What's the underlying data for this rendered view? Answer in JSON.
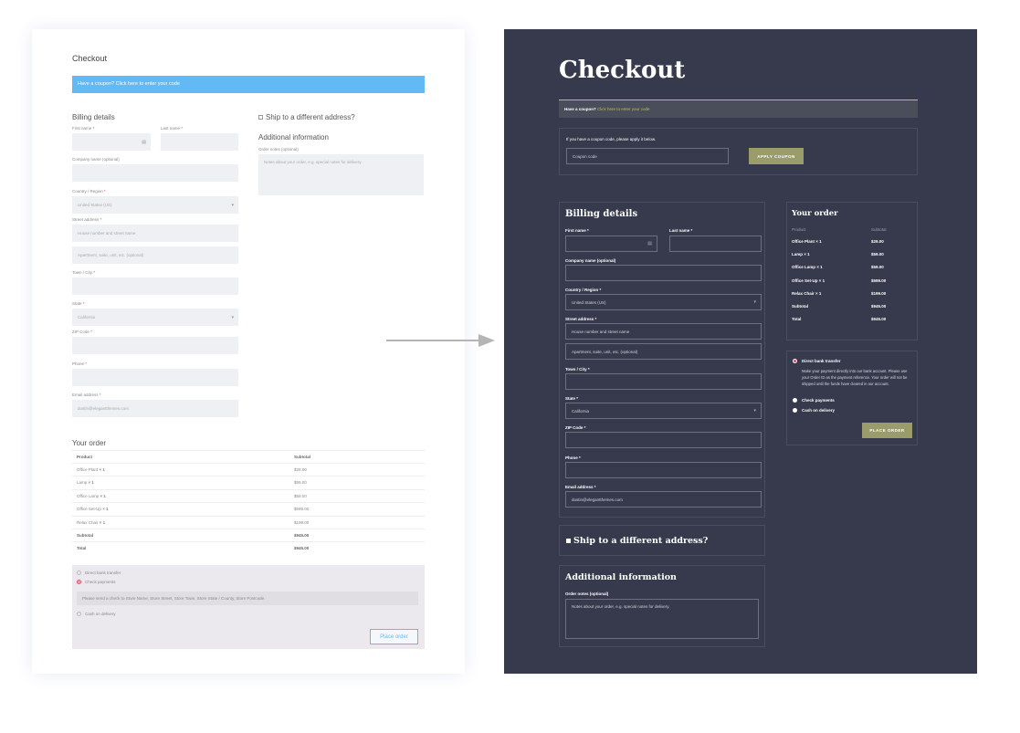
{
  "light": {
    "title": "Checkout",
    "coupon_text": "Have a coupon? Click here to enter your code",
    "billing_title": "Billing details",
    "first_name": "First name",
    "last_name": "Last name",
    "required": "*",
    "company": "Company name (optional)",
    "country_label": "Country / Region",
    "country_value": "United States (US)",
    "street_label": "Street address",
    "street_ph1": "House number and street name",
    "street_ph2": "Apartment, suite, unit, etc. (optional)",
    "town_label": "Town / City",
    "state_label": "State",
    "state_value": "California",
    "zip_label": "ZIP Code",
    "phone_label": "Phone",
    "email_label": "Email address",
    "email_value": "dustin@elegantthemes.com",
    "ship_label": "Ship to a different address?",
    "additional_title": "Additional information",
    "notes_label": "Order notes (optional)",
    "notes_ph": "Notes about your order, e.g. special notes for delivery.",
    "order_title": "Your order",
    "col_product": "Product",
    "col_subtotal": "Subtotal",
    "items": [
      {
        "name": "Office Plant",
        "qty": "× 1",
        "price": "$29.00"
      },
      {
        "name": "Lamp",
        "qty": "× 1",
        "price": "$59.00"
      },
      {
        "name": "Office Lamp",
        "qty": "× 1",
        "price": "$59.00"
      },
      {
        "name": "Office Set-Up",
        "qty": "× 1",
        "price": "$599.00"
      },
      {
        "name": "Relax Chair",
        "qty": "× 1",
        "price": "$199.00"
      }
    ],
    "subtotal_label": "Subtotal",
    "subtotal_value": "$945.00",
    "total_label": "Total",
    "total_value": "$945.00",
    "pay_bank": "Direct bank transfer",
    "pay_check": "Check payments",
    "pay_check_note": "Please send a check to Store Name, Store Street, Store Town, Store State / County, Store Postcode.",
    "pay_cod": "Cash on delivery",
    "place_order": "Place order"
  },
  "dark": {
    "title": "Checkout",
    "coupon_prefix": "Have a coupon?",
    "coupon_link": "Click here to enter your code",
    "coupon_hint": "If you have a coupon code, please apply it below.",
    "coupon_ph": "Coupon code",
    "apply_coupon": "APPLY COUPON",
    "billing_title": "Billing details",
    "first_name": "First name *",
    "last_name": "Last name *",
    "company": "Company name (optional)",
    "country_label": "Country / Region *",
    "country_value": "United States (US)",
    "street_label": "Street address *",
    "street_ph1": "House number and street name",
    "street_ph2": "Apartment, suite, unit, etc. (optional)",
    "town_label": "Town / City *",
    "state_label": "State *",
    "state_value": "California",
    "zip_label": "ZIP Code *",
    "phone_label": "Phone *",
    "email_label": "Email address *",
    "email_value": "dustin@elegantthemes.com",
    "ship_label": "Ship to a different address?",
    "additional_title": "Additional information",
    "notes_label": "Order notes (optional)",
    "notes_ph": "Notes about your order, e.g. special notes for delivery.",
    "order_title": "Your order",
    "col_product": "Product",
    "col_subtotal": "Subtotal",
    "items": [
      {
        "name": "Office Plant",
        "qty": "× 1",
        "price": "$29.00"
      },
      {
        "name": "Lamp",
        "qty": "× 1",
        "price": "$59.00"
      },
      {
        "name": "Office Lamp",
        "qty": "× 1",
        "price": "$59.00"
      },
      {
        "name": "Office Set-Up",
        "qty": "× 1",
        "price": "$599.00"
      },
      {
        "name": "Relax Chair",
        "qty": "× 1",
        "price": "$199.00"
      }
    ],
    "subtotal_label": "Subtotal",
    "subtotal_value": "$945.00",
    "total_label": "Total",
    "total_value": "$945.00",
    "pay_bank": "Direct bank transfer",
    "pay_bank_note": "Make your payment directly into our bank account. Please use your Order ID as the payment reference. Your order will not be shipped until the funds have cleared in our account.",
    "pay_check": "Check payments",
    "pay_cod": "Cash on delivery",
    "place_order": "PLACE ORDER"
  },
  "colors": {
    "light_accent": "#63b9f4",
    "dark_bg": "#363a4c",
    "dark_button": "#9a9d6b",
    "required_red": "#e0436a",
    "coupon_link": "#b7c05a"
  },
  "icons": [
    "contact-card-icon",
    "chevron-down-icon",
    "arrow-right-icon",
    "checkbox-icon",
    "radio-icon"
  ]
}
